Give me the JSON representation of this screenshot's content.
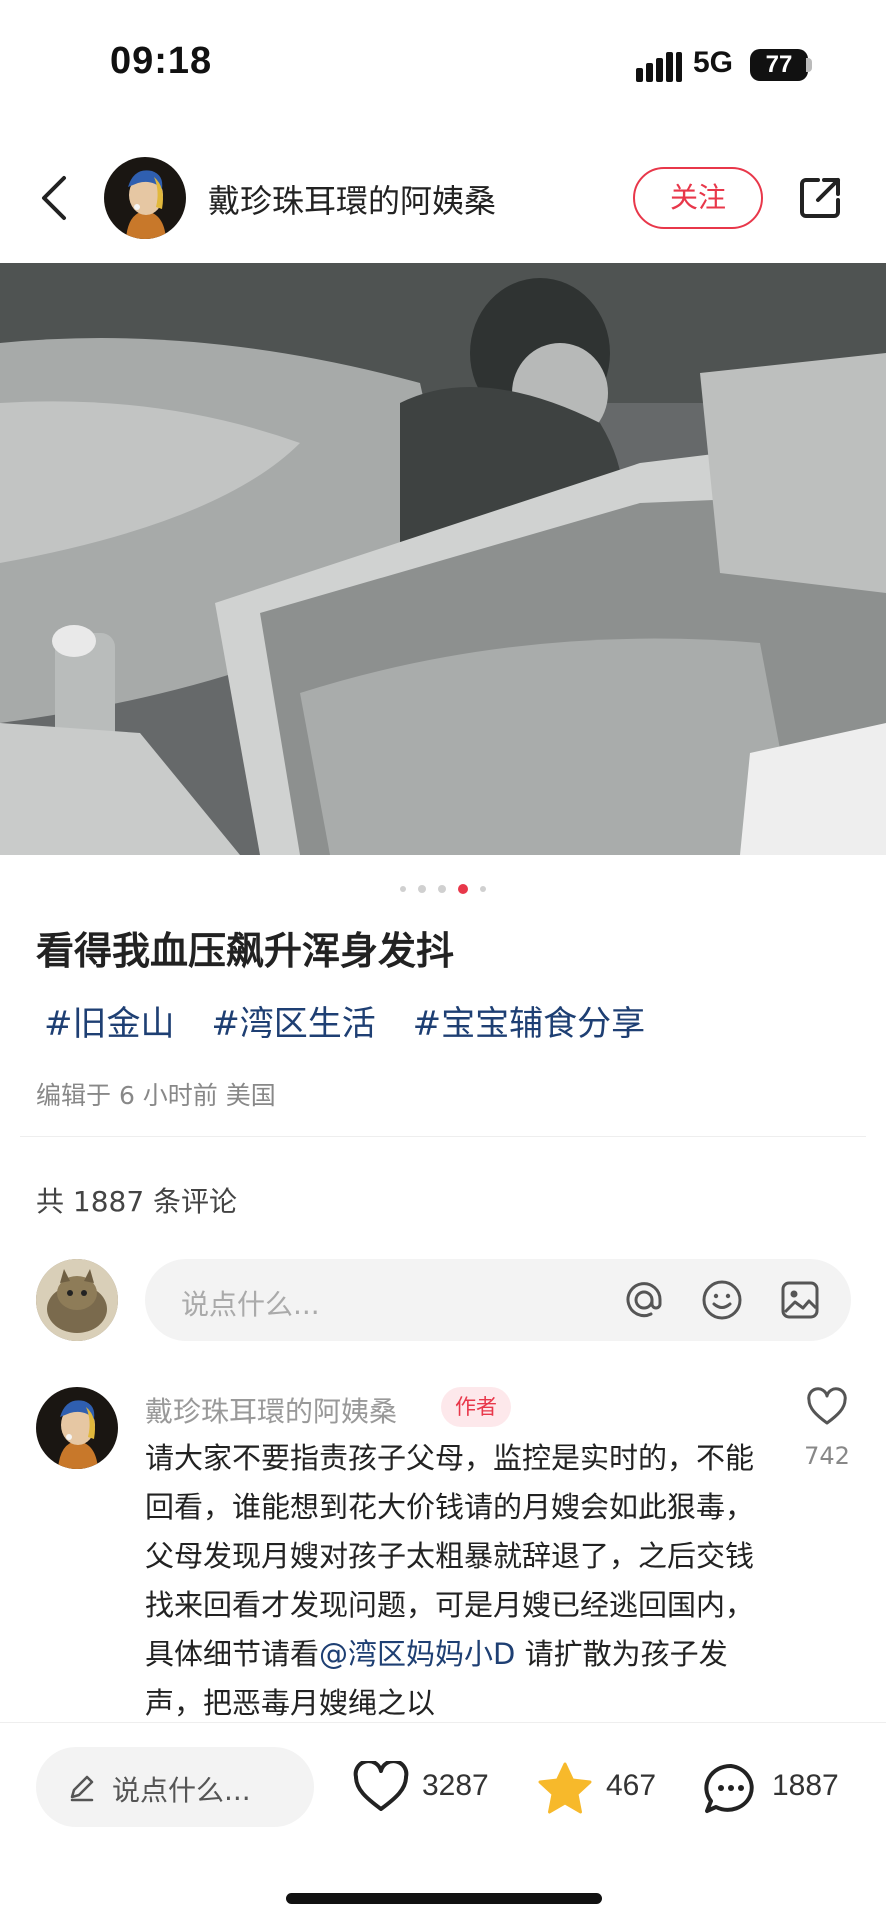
{
  "status": {
    "time": "09:18",
    "network": "5G",
    "battery": "77"
  },
  "header": {
    "author_name": "戴珍珠耳環的阿姨桑",
    "follow_label": "关注"
  },
  "carousel": {
    "total": 5,
    "active_index": 3
  },
  "post": {
    "title": "看得我血压飙升浑身发抖",
    "tags": [
      "#旧金山",
      "#湾区生活",
      "#宝宝辅食分享"
    ],
    "meta": "编辑于 6 小时前 美国"
  },
  "comments_section": {
    "count_text": "共 1887 条评论",
    "input_placeholder": "说点什么..."
  },
  "top_comment": {
    "author": "戴珍珠耳環的阿姨桑",
    "badge": "作者",
    "likes": "742",
    "text_before": "请大家不要指责孩子父母，监控是实时的，不能回看，谁能想到花大价钱请的月嫂会如此狠毒，父母发现月嫂对孩子太粗暴就辞退了，之后交钱找来回看才发现问题，可是月嫂已经逃回国内，具体细节请看",
    "mention": "@湾区妈妈小D",
    "text_after": "请扩散为孩子发声，把恶毒月嫂绳之以"
  },
  "bottom_bar": {
    "input_placeholder": "说点什么...",
    "likes": "3287",
    "favorites": "467",
    "comments": "1887"
  },
  "colors": {
    "accent": "#e8374a",
    "tag": "#1e3f73",
    "star": "#f7b92b"
  }
}
